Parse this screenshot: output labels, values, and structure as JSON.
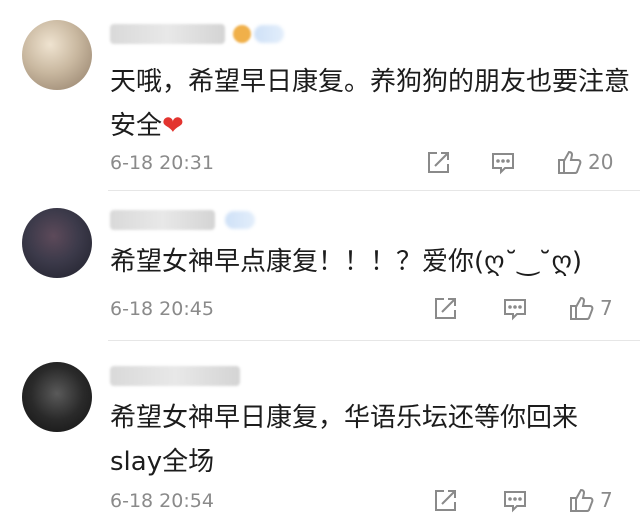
{
  "comments": [
    {
      "text": "天哦，希望早日康复。养狗狗的朋友也要注意安全",
      "emoji": "❤",
      "time": "6-18 20:31",
      "likes": "20",
      "avatar_color": "#c9b8a0"
    },
    {
      "text": "希望女神早点康复！！！？爱你(ღ˘‿˘ღ)",
      "emoji": "",
      "time": "6-18 20:45",
      "likes": "7",
      "avatar_color": "#3c3a4a"
    },
    {
      "text": "希望女神早日康复，华语乐坛还等你回来slay全场",
      "emoji": "",
      "time": "6-18 20:54",
      "likes": "7",
      "avatar_color": "#2a2a2a"
    }
  ],
  "icons": {
    "share": "share-icon",
    "comment": "comment-icon",
    "like": "thumbs-up-icon"
  },
  "colors": {
    "meta_gray": "#8a8a8a",
    "heart_red": "#e3342f"
  }
}
